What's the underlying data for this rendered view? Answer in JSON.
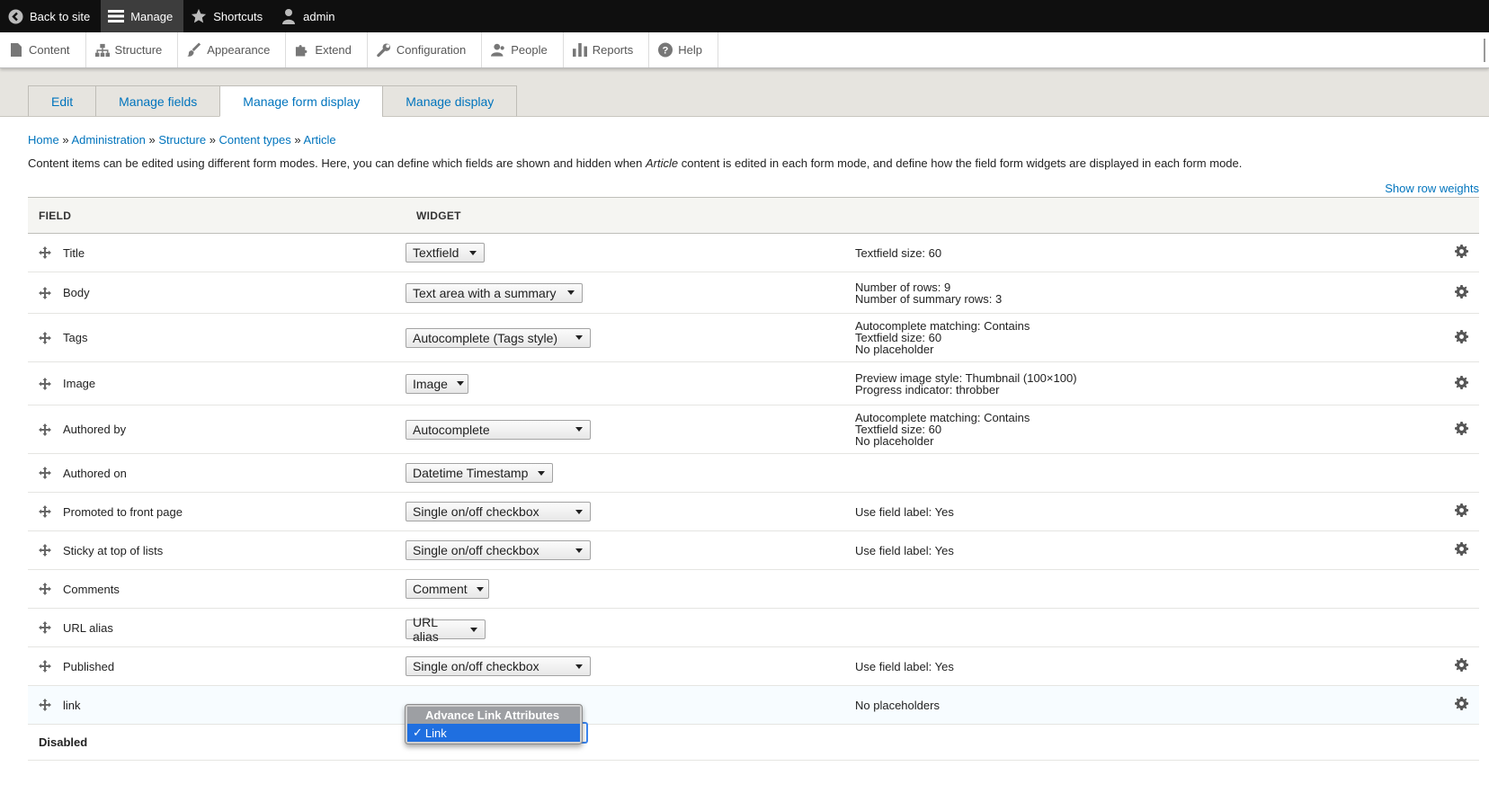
{
  "toolbar": {
    "back": "Back to site",
    "manage": "Manage",
    "shortcuts": "Shortcuts",
    "user": "admin"
  },
  "tray": {
    "items": [
      "Content",
      "Structure",
      "Appearance",
      "Extend",
      "Configuration",
      "People",
      "Reports",
      "Help"
    ]
  },
  "tabs": [
    "Edit",
    "Manage fields",
    "Manage form display",
    "Manage display"
  ],
  "breadcrumb": {
    "items": [
      "Home",
      "Administration",
      "Structure",
      "Content types",
      "Article"
    ],
    "sep": "»"
  },
  "help": {
    "before": "Content items can be edited using different form modes. Here, you can define which fields are shown and hidden when ",
    "emph": "Article",
    "after": " content is edited in each form mode, and define how the field form widgets are displayed in each form mode."
  },
  "show_weights": "Show row weights",
  "table": {
    "headers": {
      "field": "FIELD",
      "widget": "WIDGET"
    },
    "rows": [
      {
        "field": "Title",
        "widget": "Textfield",
        "summary": [
          "Textfield size: 60"
        ],
        "gear": true
      },
      {
        "field": "Body",
        "widget": "Text area with a summary",
        "summary": [
          "Number of rows: 9",
          "Number of summary rows: 3"
        ],
        "gear": true
      },
      {
        "field": "Tags",
        "widget": "Autocomplete (Tags style)",
        "summary": [
          "Autocomplete matching: Contains",
          "Textfield size: 60",
          "No placeholder"
        ],
        "gear": true
      },
      {
        "field": "Image",
        "widget": "Image",
        "summary": [
          "Preview image style: Thumbnail (100×100)",
          "Progress indicator: throbber"
        ],
        "gear": true
      },
      {
        "field": "Authored by",
        "widget": "Autocomplete",
        "summary": [
          "Autocomplete matching: Contains",
          "Textfield size: 60",
          "No placeholder"
        ],
        "gear": true
      },
      {
        "field": "Authored on",
        "widget": "Datetime Timestamp",
        "summary": [],
        "gear": false
      },
      {
        "field": "Promoted to front page",
        "widget": "Single on/off checkbox",
        "summary": [
          "Use field label: Yes"
        ],
        "gear": true
      },
      {
        "field": "Sticky at top of lists",
        "widget": "Single on/off checkbox",
        "summary": [
          "Use field label: Yes"
        ],
        "gear": true
      },
      {
        "field": "Comments",
        "widget": "Comment",
        "summary": [],
        "gear": false
      },
      {
        "field": "URL alias",
        "widget": "URL alias",
        "summary": [],
        "gear": false
      },
      {
        "field": "Published",
        "widget": "Single on/off checkbox",
        "summary": [
          "Use field label: Yes"
        ],
        "gear": true
      },
      {
        "field": "link",
        "widget": "Link",
        "summary": [
          "No placeholders"
        ],
        "gear": true
      }
    ],
    "disabled_label": "Disabled"
  },
  "dropdown": {
    "header": "Advance Link Attributes",
    "check": "✓",
    "selected": "Link"
  }
}
